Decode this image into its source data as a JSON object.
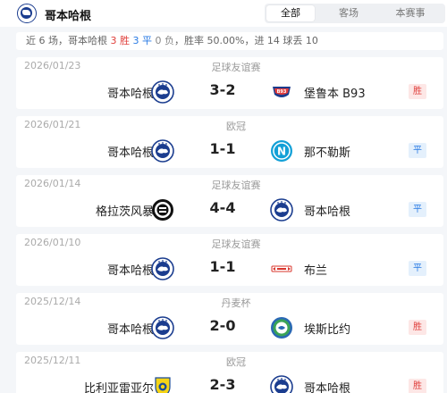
{
  "header": {
    "title": "哥本哈根",
    "tabs": [
      {
        "label": "全部",
        "active": true
      },
      {
        "label": "客场",
        "active": false
      },
      {
        "label": "本赛事",
        "active": false
      }
    ]
  },
  "summary": {
    "prefix": "近 6 场，",
    "team": "哥本哈根 ",
    "wins": "3 胜 ",
    "draws": "3 平 ",
    "losses": "0 负",
    "rest": "，胜率 50.00%，进 14 球丢 10"
  },
  "matches": [
    {
      "date": "2026/01/23",
      "competition": "足球友谊赛",
      "home": "哥本哈根",
      "home_logo": "copenhagen-logo",
      "score": "3-2",
      "away": "堡鲁本 B93",
      "away_logo": "b93-logo",
      "result": "胜",
      "result_type": "win"
    },
    {
      "date": "2026/01/21",
      "competition": "欧冠",
      "home": "哥本哈根",
      "home_logo": "copenhagen-logo",
      "score": "1-1",
      "away": "那不勒斯",
      "away_logo": "napoli-logo",
      "result": "平",
      "result_type": "draw"
    },
    {
      "date": "2026/01/14",
      "competition": "足球友谊赛",
      "home": "格拉茨风暴",
      "home_logo": "sturm-graz-logo",
      "score": "4-4",
      "away": "哥本哈根",
      "away_logo": "copenhagen-logo",
      "result": "平",
      "result_type": "draw"
    },
    {
      "date": "2026/01/10",
      "competition": "足球友谊赛",
      "home": "哥本哈根",
      "home_logo": "copenhagen-logo",
      "score": "1-1",
      "away": "布兰",
      "away_logo": "brann-logo",
      "result": "平",
      "result_type": "draw"
    },
    {
      "date": "2025/12/14",
      "competition": "丹麦杯",
      "home": "哥本哈根",
      "home_logo": "copenhagen-logo",
      "score": "2-0",
      "away": "埃斯比约",
      "away_logo": "esbjerg-logo",
      "result": "胜",
      "result_type": "win"
    },
    {
      "date": "2025/12/11",
      "competition": "欧冠",
      "home": "比利亚雷亚尔",
      "home_logo": "villarreal-logo",
      "score": "2-3",
      "away": "哥本哈根",
      "away_logo": "copenhagen-logo",
      "result": "胜",
      "result_type": "win"
    }
  ]
}
